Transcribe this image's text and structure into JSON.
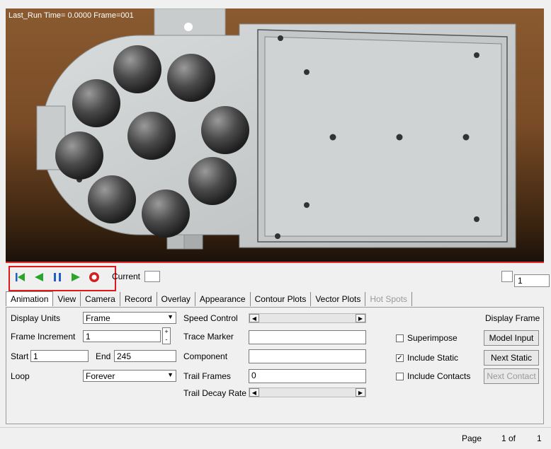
{
  "viewport": {
    "title": "Last_Run  Time= 0.0000 Frame=001"
  },
  "controls": {
    "current_label": "Current",
    "frame_value": "1"
  },
  "tabs": [
    {
      "label": "Animation"
    },
    {
      "label": "View"
    },
    {
      "label": "Camera"
    },
    {
      "label": "Record"
    },
    {
      "label": "Overlay"
    },
    {
      "label": "Appearance"
    },
    {
      "label": "Contour Plots"
    },
    {
      "label": "Vector Plots"
    },
    {
      "label": "Hot Spots"
    }
  ],
  "panel": {
    "display_units_label": "Display Units",
    "display_units_value": "Frame",
    "frame_increment_label": "Frame Increment",
    "frame_increment_value": "1",
    "start_label": "Start",
    "start_value": "1",
    "end_label": "End",
    "end_value": "245",
    "loop_label": "Loop",
    "loop_value": "Forever",
    "speed_control_label": "Speed Control",
    "trace_marker_label": "Trace Marker",
    "trace_marker_value": "",
    "component_label": "Component",
    "component_value": "",
    "trail_frames_label": "Trail Frames",
    "trail_frames_value": "0",
    "trail_decay_label": "Trail Decay Rate",
    "superimpose_label": "Superimpose",
    "superimpose_checked": false,
    "include_static_label": "Include Static",
    "include_static_checked": true,
    "include_contacts_label": "Include Contacts",
    "include_contacts_checked": false,
    "display_frame_label": "Display Frame",
    "model_input_label": "Model Input",
    "next_static_label": "Next Static",
    "next_contact_label": "Next Contact"
  },
  "status": {
    "page_label": "Page",
    "page_value": "1 of",
    "page_total": "1"
  },
  "colors": {
    "highlight_box": "#e01818",
    "play_green": "#2aa52a",
    "pause_blue": "#2060c0",
    "record_red": "#d02020"
  }
}
